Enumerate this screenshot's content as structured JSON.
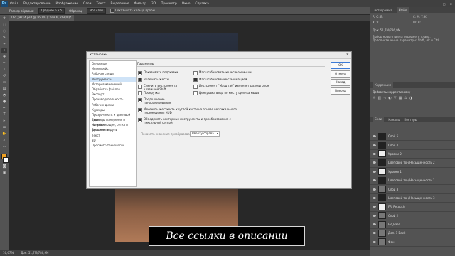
{
  "menubar": {
    "logo": "Ps",
    "items": [
      "Файл",
      "Редактирование",
      "Изображение",
      "Слои",
      "Текст",
      "Выделение",
      "Фильтр",
      "3D",
      "Просмотр",
      "Окно",
      "Справка"
    ]
  },
  "options": {
    "sample_label": "Размер образца:",
    "sample_value": "Среднее 5 x 5",
    "layer_label": "Образец:",
    "layer_value": "Все слои",
    "ring_label": "Показывать кольцо пробы"
  },
  "document": {
    "tab_title": "DVC_9714.psd @ 16,7% (Слой 6, RGB/8)*"
  },
  "statusbar": {
    "zoom": "16,67%",
    "doc": "Док: 51,7M/786,9M"
  },
  "rightpanel": {
    "tabs_top": [
      "Гистограмма",
      "Инфо"
    ],
    "doc_info": "Док: 51,7M/786,9M",
    "hint": "Выбор нового цвета переднего плана. Дополнительные параметры: Shift, Alt и Ctrl.",
    "corrections_label": "Коррекция",
    "corrections_sub": "Добавить корректировку",
    "layer_tabs": [
      "Слои",
      "Каналы",
      "Контуры"
    ],
    "layers": [
      {
        "name": "Слой 5",
        "thumb": "dark"
      },
      {
        "name": "Слой 4",
        "thumb": "dark"
      },
      {
        "name": "Уровни 2",
        "thumb": "white"
      },
      {
        "name": "Цветовой тон/Насыщенность 2",
        "thumb": "dark"
      },
      {
        "name": "Уровни 1",
        "thumb": "white"
      },
      {
        "name": "Цветовой тон/Насыщенность 1",
        "thumb": "dark"
      },
      {
        "name": "Слой 3",
        "thumb": "grey"
      },
      {
        "name": "Цветовой тон/Насыщенность 3",
        "thumb": "dark"
      },
      {
        "name": "FR_Retouch",
        "thumb": "white"
      },
      {
        "name": "Слой 2",
        "thumb": "grey"
      },
      {
        "name": "FR_Base",
        "thumb": "grey"
      },
      {
        "name": "Доп. 1 Back",
        "thumb": "grey"
      },
      {
        "name": "Фон",
        "thumb": "grey"
      }
    ]
  },
  "dialog": {
    "title": "Установки",
    "nav": [
      "Основные",
      "Интерфейс",
      "Рабочая среда",
      "Инструменты",
      "История изменений",
      "Обработка файлов",
      "Экспорт",
      "Производительность",
      "Рабочие диски",
      "Курсоры",
      "Прозрачность и цветовой охват",
      "Единицы измерения и линейки",
      "Направляющие, сетка и фрагменты",
      "Внешние модули",
      "Текст",
      "3D",
      "Просмотр технологии"
    ],
    "selected_index": 3,
    "section_title": "Параметры",
    "options_left": [
      {
        "label": "Показывать подсказки",
        "checked": true
      },
      {
        "label": "Включить жесты",
        "checked": true
      },
      {
        "label": "Сменить инструмента клавишей Shift",
        "checked": false
      },
      {
        "label": "Прокрутка",
        "checked": false
      },
      {
        "label": "Продолжение панорамирования",
        "checked": true
      }
    ],
    "options_right": [
      {
        "label": "Масштабировать колесиком мыши",
        "checked": false
      },
      {
        "label": "Масштабирование с анимацией",
        "checked": true
      },
      {
        "label": "Инструмент \"Масштаб\" изменяет размер окон",
        "checked": false
      },
      {
        "label": "Центровка вида по месту щелчка мыши",
        "checked": false
      }
    ],
    "options_bottom": [
      {
        "label": "Изменить жесткость круглой кисти на основе вертикального перемещения HUD",
        "checked": true
      },
      {
        "label": "Объединять векторные инструменты и преобразования с пиксельной сеткой",
        "checked": true
      }
    ],
    "transform_label": "Показать значения преобразования:",
    "transform_value": "Вверху справа",
    "buttons": [
      "OK",
      "Отмена",
      "Назад",
      "Вперед"
    ]
  },
  "caption": "Все ссылки в описании"
}
